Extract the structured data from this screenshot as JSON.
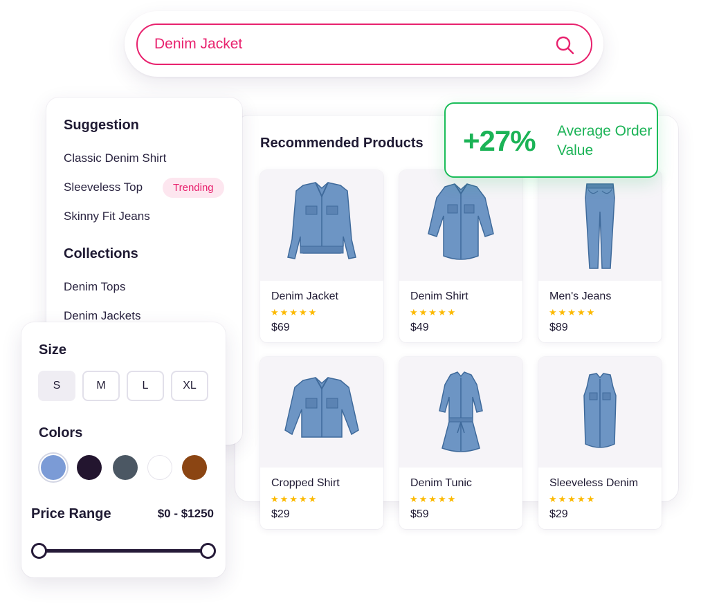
{
  "search": {
    "value": "Denim Jacket"
  },
  "products": {
    "title": "Recommended Products",
    "items": [
      {
        "name": "Denim Jacket",
        "rating": "★★★★★",
        "price": "$69"
      },
      {
        "name": "Denim Shirt",
        "rating": "★★★★★",
        "price": "$49"
      },
      {
        "name": "Men's Jeans",
        "rating": "★★★★★",
        "price": "$89"
      },
      {
        "name": "Cropped Shirt",
        "rating": "★★★★★",
        "price": "$29"
      },
      {
        "name": "Denim Tunic",
        "rating": "★★★★★",
        "price": "$59"
      },
      {
        "name": "Sleeveless Denim",
        "rating": "★★★★★",
        "price": "$29"
      }
    ]
  },
  "stat": {
    "value": "+27%",
    "label": "Average Order Value"
  },
  "suggestions": {
    "heading": "Suggestion",
    "items": [
      "Classic Denim Shirt",
      "Sleeveless Top",
      "Skinny Fit Jeans"
    ],
    "badge": "Trending",
    "collections_heading": "Collections",
    "collections": [
      "Denim Tops",
      "Denim Jackets"
    ]
  },
  "filters": {
    "size_heading": "Size",
    "sizes": [
      "S",
      "M",
      "L",
      "XL"
    ],
    "selected_size": "S",
    "colors_heading": "Colors",
    "colors": [
      "#7b9bd6",
      "#23152f",
      "#4b5763",
      "#ffffff",
      "#8b4513"
    ],
    "selected_color": "#7b9bd6",
    "price_heading": "Price Range",
    "price_value": "$0 - $1250"
  },
  "theme": {
    "accent": "#e8226e",
    "success": "#1bbd5a",
    "star": "#fcb900",
    "denim": "#6d95c4"
  }
}
